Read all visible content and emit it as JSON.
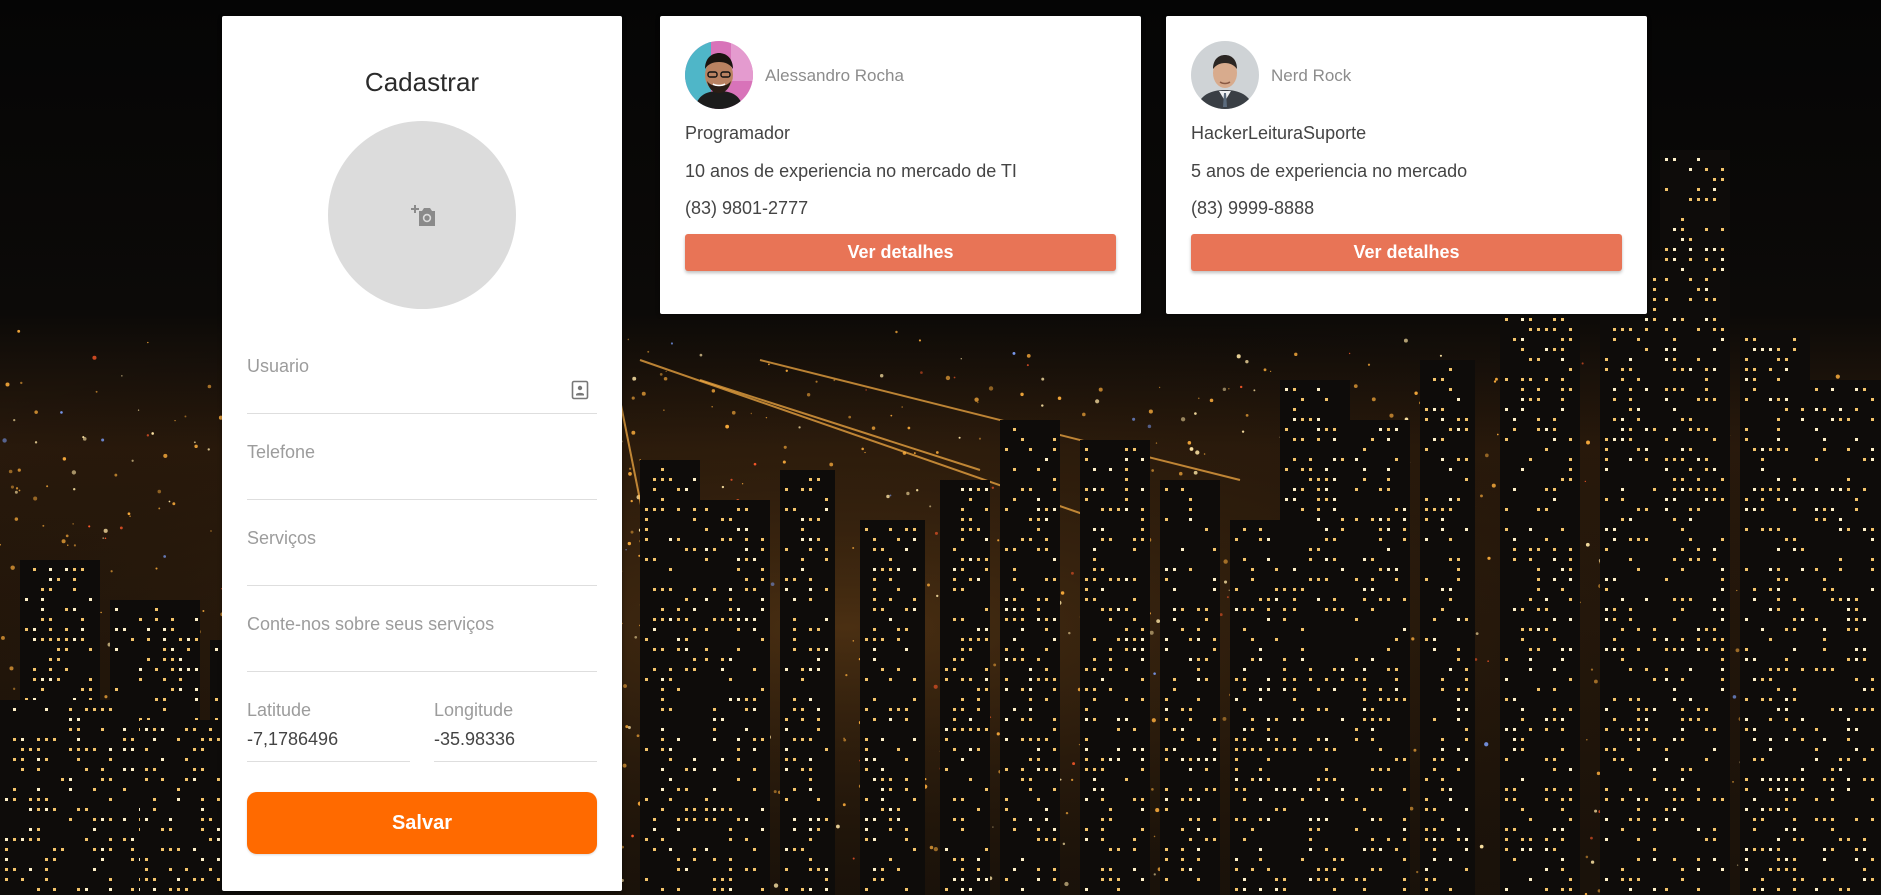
{
  "register": {
    "title": "Cadastrar",
    "photo_icon": "add-a-photo-icon",
    "fields": {
      "usuario": "Usuario",
      "telefone": "Telefone",
      "servicos": "Serviços",
      "sobre": "Conte-nos sobre seus serviços",
      "latitude_label": "Latitude",
      "latitude_value": "-7,1786496",
      "longitude_label": "Longitude",
      "longitude_value": "-35.98336"
    },
    "save_label": "Salvar"
  },
  "providers": [
    {
      "name": "Alessandro Rocha",
      "role": "Programador",
      "experience": "10 anos de experiencia no mercado de TI",
      "phone": "(83) 9801-2777",
      "button": "Ver detalhes"
    },
    {
      "name": "Nerd Rock",
      "role": "HackerLeituraSuporte",
      "experience": "5 anos de experiencia no mercado",
      "phone": "(83) 9999-8888",
      "button": "Ver detalhes"
    }
  ],
  "colors": {
    "save_button": "#ff6a00",
    "details_button": "#e87456",
    "card_background": "#ffffff",
    "photo_placeholder": "#dcdcdc"
  }
}
